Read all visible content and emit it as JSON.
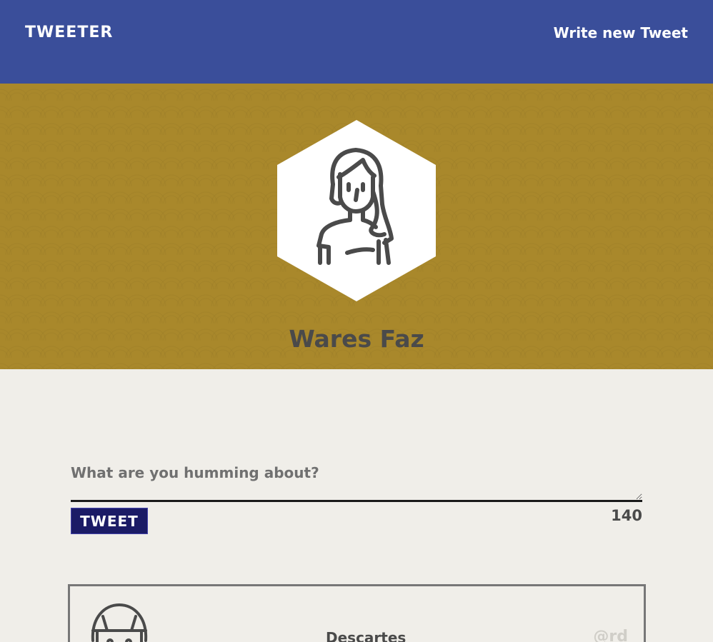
{
  "nav": {
    "brand": "TWEETER",
    "compose_link": "Write new Tweet",
    "background": "#3a4e9a"
  },
  "profile": {
    "name": "Wares Faz",
    "avatar_icon": "woman-avatar-icon",
    "header_background": "#a9882b"
  },
  "compose": {
    "placeholder": "What are you humming about?",
    "value": "",
    "button_label": "TWEET",
    "counter": "140"
  },
  "tweets": [
    {
      "name": "Descartes",
      "handle": "@rd",
      "avatar_icon": "man-avatar-icon"
    }
  ]
}
